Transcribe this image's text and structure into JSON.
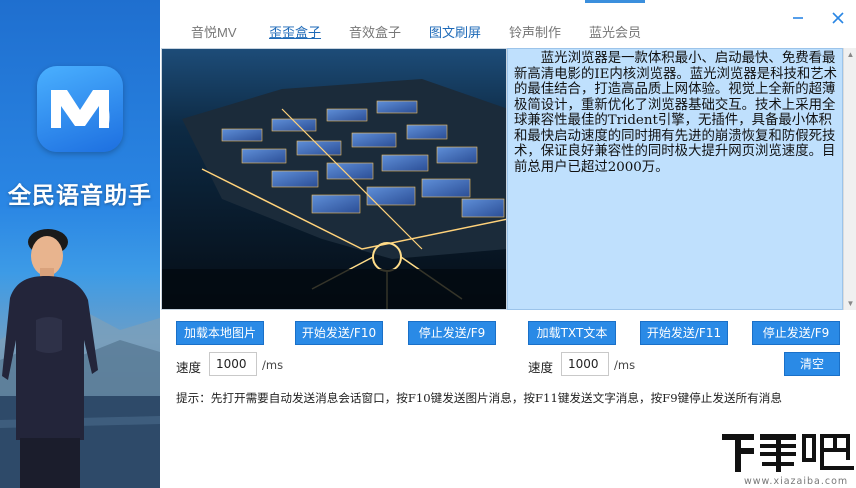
{
  "sidebar": {
    "app_name": "全民语音助手",
    "logo_icon": "m-logo-icon",
    "colors": {
      "brand": "#2a86e4"
    }
  },
  "tabs": [
    {
      "label": "音悦MV"
    },
    {
      "label": "歪歪盒子"
    },
    {
      "label": "音效盒子"
    },
    {
      "label": "图文刷屏"
    },
    {
      "label": "铃声制作"
    },
    {
      "label": "蓝光会员"
    }
  ],
  "window": {
    "minimize_icon": "minimize-icon",
    "close_icon": "close-icon"
  },
  "preview": {
    "text": "蓝光浏览器是一款体积最小、启动最快、免费看最新高清电影的IE内核浏览器。蓝光浏览器是科技和艺术的最佳结合，打造高品质上网体验。视觉上全新的超薄极简设计，重新优化了浏览器基础交互。技术上采用全球兼容性最佳的Trident引擎，无插件，具备最小体积和最快启动速度的同时拥有先进的崩溃恢复和防假死技术，保证良好兼容性的同时极大提升网页浏览速度。目前总用户已超过2000万。"
  },
  "left_controls": {
    "load_button": "加载本地图片",
    "start_button": "开始发送/F10",
    "stop_button": "停止发送/F9",
    "speed_label": "速度",
    "speed_value": "1000",
    "unit": "/ms"
  },
  "right_controls": {
    "load_button": "加载TXT文本",
    "start_button": "开始发送/F11",
    "stop_button": "停止发送/F9",
    "speed_label": "速度",
    "speed_value": "1000",
    "unit": "/ms",
    "clear_button": "清空"
  },
  "hint": "提示：先打开需要自动发送消息会话窗口，按F10键发送图片消息，按F11键发送文字消息，按F9键停止发送所有消息",
  "watermark": {
    "site": "www.xiazaiba.com"
  },
  "colors": {
    "accent": "#2a8ae6",
    "panel_bg": "#bfe0fd",
    "tab_active": "#1e6ab8"
  }
}
